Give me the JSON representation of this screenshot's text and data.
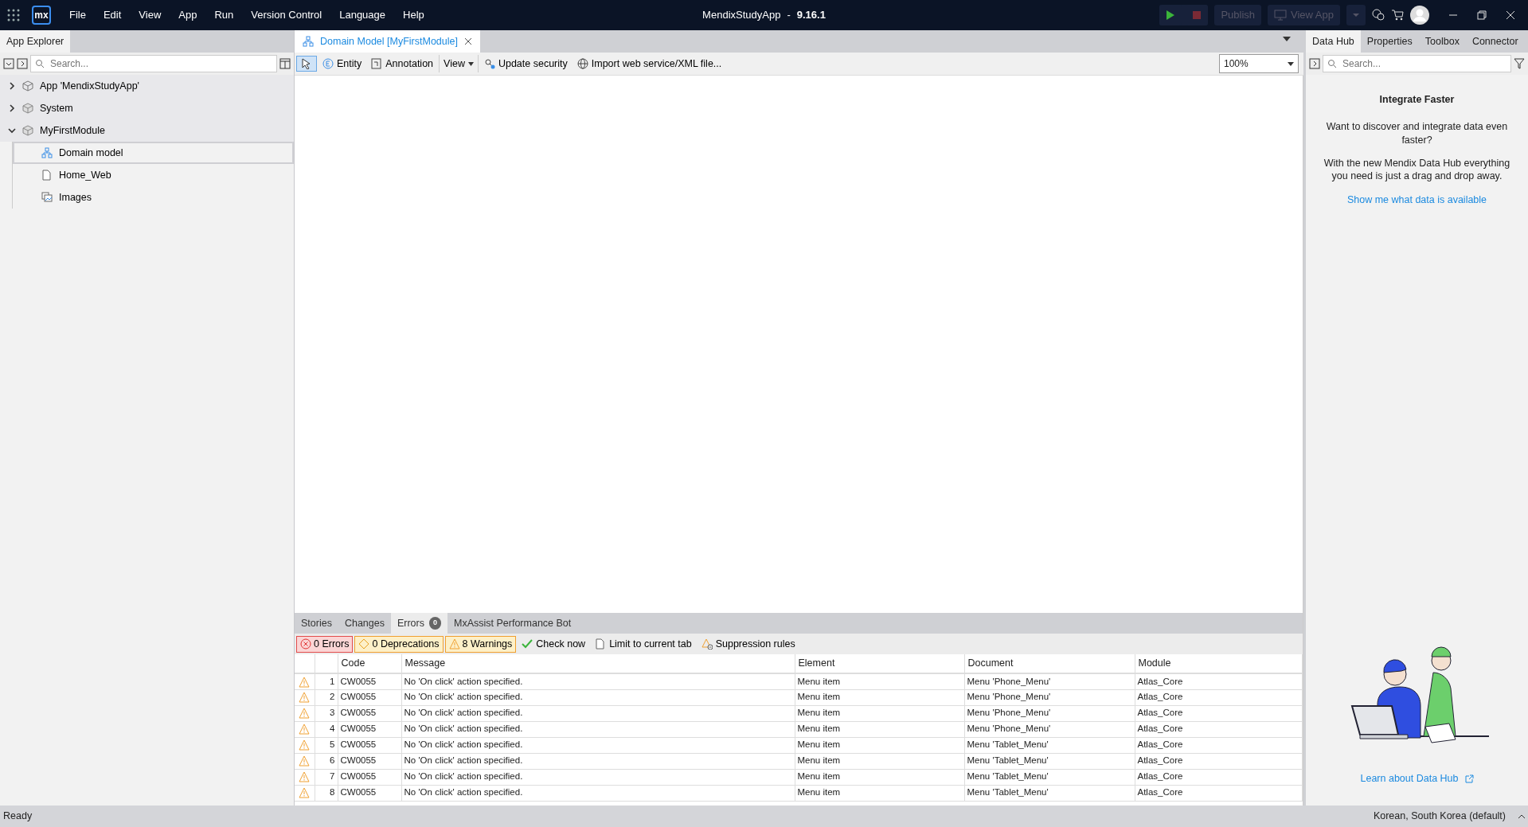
{
  "title_bar": {
    "logo": "mx",
    "menus": [
      "File",
      "Edit",
      "View",
      "App",
      "Run",
      "Version Control",
      "Language",
      "Help"
    ],
    "app_name": "MendixStudyApp",
    "separator": "-",
    "version": "9.16.1",
    "buttons": [
      "Publish",
      "View App"
    ]
  },
  "app_explorer": {
    "tab": "App Explorer",
    "search": {
      "placeholder": "Search..."
    },
    "tree": [
      {
        "label": "App 'MendixStudyApp'",
        "kind": "app",
        "expanded": false,
        "selected": false
      },
      {
        "label": "System",
        "kind": "module",
        "expanded": false,
        "selected": false
      },
      {
        "label": "MyFirstModule",
        "kind": "module",
        "expanded": true,
        "selected": false,
        "children": [
          {
            "label": "Domain model",
            "kind": "domain",
            "selected": true
          },
          {
            "label": "Home_Web",
            "kind": "page",
            "selected": false
          },
          {
            "label": "Images",
            "kind": "images",
            "selected": false
          }
        ]
      }
    ]
  },
  "editor": {
    "tabs": [
      {
        "label": "Domain Model [MyFirstModule]",
        "selected": true
      }
    ],
    "toolbar": [
      {
        "label": "Entity",
        "kind": "entity"
      },
      {
        "label": "Annotation",
        "kind": "annotation"
      },
      {
        "label": "View",
        "kind": "dropdown"
      },
      {
        "label": "Update security",
        "kind": "security"
      },
      {
        "label": "Import web service/XML file...",
        "kind": "globe"
      }
    ],
    "zoom": "100%"
  },
  "bottom_panel": {
    "tabs": [
      {
        "label": "Stories",
        "selected": false
      },
      {
        "label": "Changes",
        "selected": false
      },
      {
        "label": "Errors",
        "badge": "0",
        "selected": true
      },
      {
        "label": "MxAssist Performance Bot",
        "selected": false
      }
    ],
    "filters": [
      {
        "label": "0 Errors",
        "kind": "error"
      },
      {
        "label": "0 Deprecations",
        "kind": "deprecation"
      },
      {
        "label": "8 Warnings",
        "kind": "warning"
      }
    ],
    "actions": [
      {
        "label": "Check now",
        "kind": "check"
      },
      {
        "label": "Limit to current tab",
        "kind": "page"
      },
      {
        "label": "Suppression rules",
        "kind": "suppress"
      }
    ],
    "table": {
      "columns": [
        "Code",
        "Message",
        "Element",
        "Document",
        "Module"
      ],
      "rows": [
        {
          "number": "1",
          "code": "CW0055",
          "message": "No 'On click' action specified.",
          "element": "Menu item",
          "document": "Menu 'Phone_Menu'",
          "module": "Atlas_Core"
        },
        {
          "number": "2",
          "code": "CW0055",
          "message": "No 'On click' action specified.",
          "element": "Menu item",
          "document": "Menu 'Phone_Menu'",
          "module": "Atlas_Core"
        },
        {
          "number": "3",
          "code": "CW0055",
          "message": "No 'On click' action specified.",
          "element": "Menu item",
          "document": "Menu 'Phone_Menu'",
          "module": "Atlas_Core"
        },
        {
          "number": "4",
          "code": "CW0055",
          "message": "No 'On click' action specified.",
          "element": "Menu item",
          "document": "Menu 'Phone_Menu'",
          "module": "Atlas_Core"
        },
        {
          "number": "5",
          "code": "CW0055",
          "message": "No 'On click' action specified.",
          "element": "Menu item",
          "document": "Menu 'Tablet_Menu'",
          "module": "Atlas_Core"
        },
        {
          "number": "6",
          "code": "CW0055",
          "message": "No 'On click' action specified.",
          "element": "Menu item",
          "document": "Menu 'Tablet_Menu'",
          "module": "Atlas_Core"
        },
        {
          "number": "7",
          "code": "CW0055",
          "message": "No 'On click' action specified.",
          "element": "Menu item",
          "document": "Menu 'Tablet_Menu'",
          "module": "Atlas_Core"
        },
        {
          "number": "8",
          "code": "CW0055",
          "message": "No 'On click' action specified.",
          "element": "Menu item",
          "document": "Menu 'Tablet_Menu'",
          "module": "Atlas_Core"
        }
      ]
    }
  },
  "right_panel": {
    "tabs": [
      {
        "label": "Data Hub",
        "selected": true
      },
      {
        "label": "Properties",
        "selected": false
      },
      {
        "label": "Toolbox",
        "selected": false
      },
      {
        "label": "Connector",
        "selected": false
      }
    ],
    "search": {
      "placeholder": "Search..."
    },
    "heading": "Integrate Faster",
    "paragraphs": [
      "Want to discover and integrate data even faster?",
      "With the new Mendix Data Hub everything you need is just a drag and drop away."
    ],
    "link": "Show me what data is available",
    "learn_link": "Learn about Data Hub"
  },
  "status_bar": {
    "left": "Ready",
    "right": "Korean, South Korea (default)"
  }
}
